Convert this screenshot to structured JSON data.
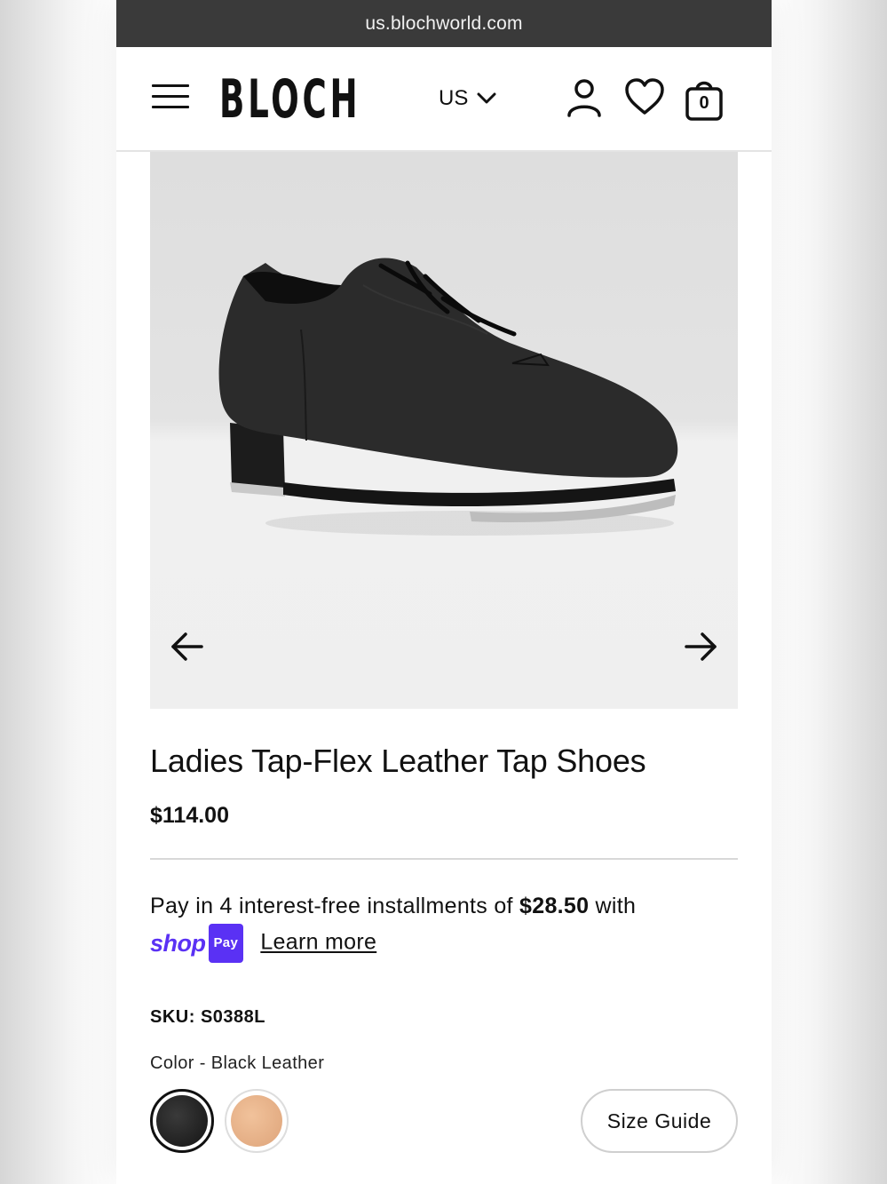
{
  "browser": {
    "url": "us.blochworld.com"
  },
  "header": {
    "logo": "BLOCH",
    "region": "US",
    "cart_count": "0"
  },
  "product": {
    "title": "Ladies Tap-Flex Leather Tap Shoes",
    "price": "$114.00",
    "installments_prefix": "Pay in 4 interest-free installments of ",
    "installments_amount": "$28.50",
    "installments_suffix": " with",
    "shop_word": "shop",
    "pay_badge": "Pay",
    "learn_more": "Learn more",
    "sku": "SKU: S0388L",
    "color_label": "Color - Black Leather",
    "size_guide": "Size Guide"
  },
  "colors": {
    "brand_purple": "#5a31f4",
    "swatch_black": "#1a1a1a",
    "swatch_tan": "#e6b088"
  }
}
